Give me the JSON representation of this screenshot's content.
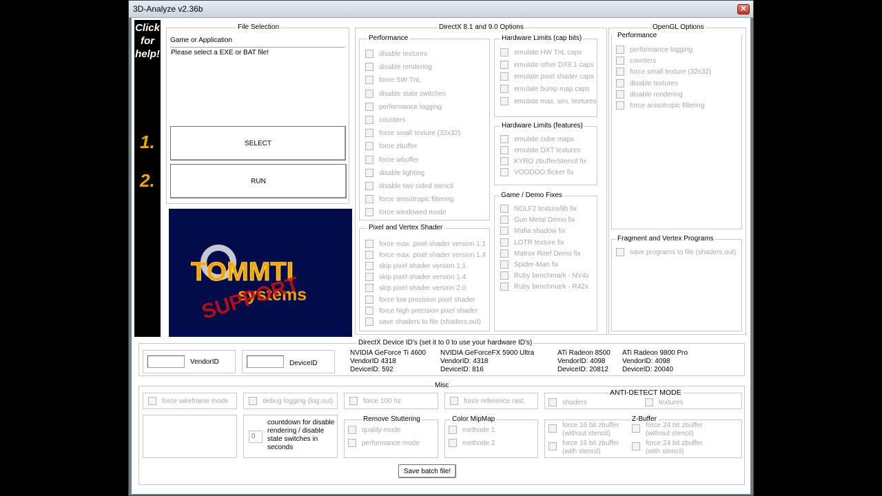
{
  "window": {
    "title": "3D-Analyze v2.36b",
    "close_icon": "x-icon"
  },
  "help": {
    "text_lines": [
      "Click",
      "for",
      "help!"
    ],
    "step1": "1.",
    "step2": "2."
  },
  "file_selection": {
    "title": "File Selection",
    "label": "Game or Application",
    "value": "Please select a EXE or BAT file!",
    "select_label": "SELECT",
    "run_label": "RUN"
  },
  "logo": {
    "word1": "TOMMTI",
    "word2": "systems",
    "stamp": "SUPPORT"
  },
  "dx": {
    "title": "DirectX 8.1 and 9.0 Options",
    "performance": {
      "title": "Performance",
      "items": [
        "disable textures",
        "disable rendering",
        "force SW TnL",
        "disable state switches",
        "performance logging",
        "counters",
        "force small texture (32x32)",
        "force zbuffer",
        "force wbuffer",
        "disable lighting",
        "disable two sided stencil",
        "force anisotropic filtering",
        "force windowed mode"
      ]
    },
    "shader": {
      "title": "Pixel and Vertex Shader",
      "items": [
        "force max. pixel shader version 1.1",
        "force max. pixel shader version 1.4",
        "skip pixel shader version 1.1",
        "skip pixel shader version 1.4",
        "skip pixel shader version 2.0",
        "force low precision pixel shader",
        "force high precision pixel shader",
        "save shaders to file (shaders.out)"
      ]
    },
    "caps": {
      "title": "Hardware Limits (cap bits)",
      "items": [
        "emulate HW TnL caps",
        "emulate other DX8.1 caps",
        "emulate pixel shader caps",
        "emulate bump map caps",
        "emulate max. sim. textures"
      ]
    },
    "features": {
      "title": "Hardware Limits (features)",
      "items": [
        "emulate cube maps",
        "emulate DXT textures",
        "KYRO zbuffer/stencil fix",
        "VOODOO flicker fix"
      ]
    },
    "fixes": {
      "title": "Game / Demo Fixes",
      "items": [
        "NOLF2 texture/lib fix",
        "Gun Metal Demo fix",
        "Mafia shadow fix",
        "LOTR texture fix",
        "Matrox Reef Demo fix",
        "Spider-Man fix",
        "Ruby benchmark - NV4x",
        "Ruby benchmark - R42x"
      ]
    }
  },
  "gl": {
    "title": "OpenGL Options",
    "performance": {
      "title": "Performance",
      "items": [
        "performance logging",
        "counters",
        "force small texture (32x32)",
        "disable textures",
        "disable rendering",
        "force anisotropic filtering"
      ]
    },
    "fragment": {
      "title": "Fragment and Vertex Programs",
      "items": [
        "save programs to file (shaders.out)"
      ]
    }
  },
  "device_ids": {
    "title": "DirectX Device ID's (set it to 0 to use your hardware ID's)",
    "vendor_label": "VendorID",
    "device_label": "DeviceID",
    "vendor_value": "",
    "device_value": "",
    "cards": [
      {
        "name": "NVIDIA GeForce Ti 4600",
        "vendor": "VendorID 4318",
        "device": "DeviceID: 592"
      },
      {
        "name": "NVIDIA GeForceFX 5900 Ultra",
        "vendor": "VendorID: 4318",
        "device": "DeviceID: 816"
      },
      {
        "name": "ATi Radeon 8500",
        "vendor": "VendorID: 4098",
        "device": "DeviceID: 20812"
      },
      {
        "name": "ATi Radeon 9800 Pro",
        "vendor": "VendorID: 4098",
        "device": "DeviceID: 20040"
      }
    ]
  },
  "misc": {
    "title": "Misc",
    "wireframe": "force wireframe mode",
    "debug": "debug logging (log.out)",
    "hz": "force 100 hz",
    "refrast": "force reference rast.",
    "anti": {
      "title": "ANTI-DETECT MODE",
      "shaders": "shaders",
      "textures": "textures"
    },
    "countdown": {
      "value": "0",
      "label": "countdown for disable rendering / disable state switches in seconds"
    },
    "stutter": {
      "title": "Remove Stuttering",
      "items": [
        "quality mode",
        "performance mode"
      ]
    },
    "mipmap": {
      "title": "Color MipMap",
      "items": [
        "methode 1",
        "methode 2"
      ]
    },
    "zbuffer": {
      "title": "Z-Buffer",
      "items": [
        "force 16 bit zbuffer (without stencil)",
        "force 24 bit zbuffer (without stencil)",
        "force 16 bit zbuffer (with stencil)",
        "force 24 bit zbuffer (with stencil)"
      ]
    },
    "save_label": "Save batch file!"
  }
}
